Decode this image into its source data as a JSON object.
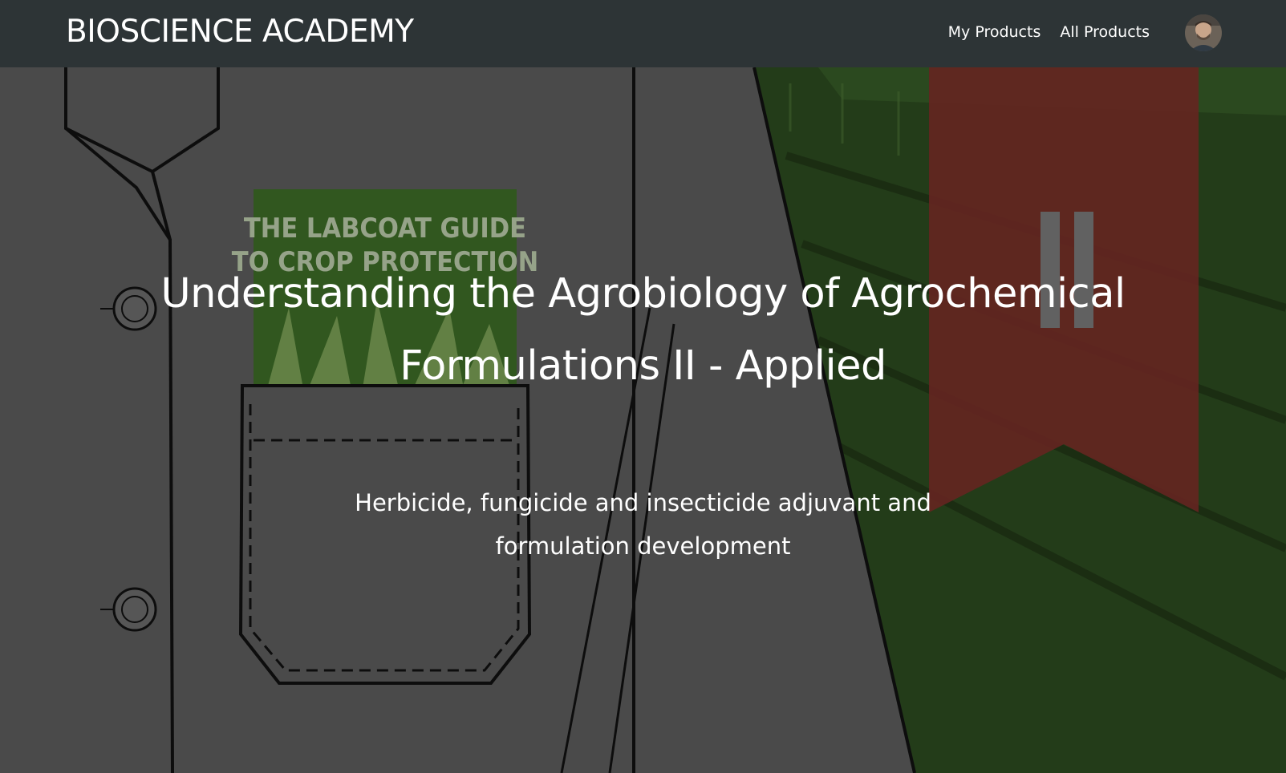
{
  "header": {
    "brand": "BIOSCIENCE ACADEMY",
    "nav": [
      {
        "label": "My Products"
      },
      {
        "label": "All Products"
      }
    ],
    "avatar_icon": "user-avatar-icon"
  },
  "hero": {
    "title": "Understanding the Agrobiology of Agrochemical Formulations II - Applied",
    "subtitle": "Herbicide, fungicide and insecticide adjuvant and formulation development",
    "book_cover_text": "THE LABCOAT GUIDE TO CROP PROTECTION",
    "bookmark_numeral": "II"
  },
  "colors": {
    "navbar": "#2d3436",
    "labcoat": "#5b5b5b",
    "bookmark": "#7a2e28",
    "field_green": "#2b4a1f",
    "text": "#ffffff"
  }
}
